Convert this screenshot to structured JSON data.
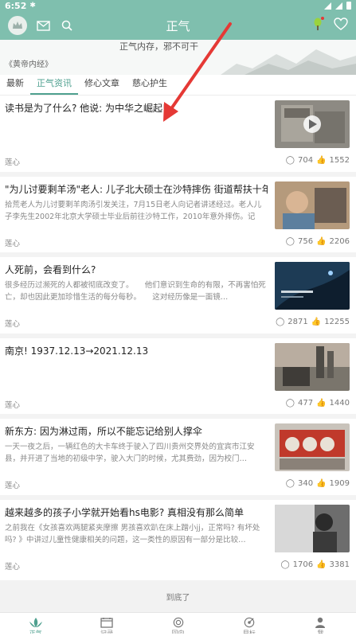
{
  "status_bar": {
    "time": "6:52"
  },
  "header": {
    "title": "正气"
  },
  "banner": {
    "verse": "正气内存，邪不可干",
    "source": "《黄帝内经》"
  },
  "tabs": [
    {
      "label": "最新",
      "active": false
    },
    {
      "label": "正气资讯",
      "active": true
    },
    {
      "label": "修心文章",
      "active": false
    },
    {
      "label": "慈心护生",
      "active": false
    }
  ],
  "articles": [
    {
      "title": "读书是为了什么? 他说: 为中华之崛起!",
      "summary": "",
      "source": "莲心",
      "comments": "704",
      "likes": "1552",
      "has_play": true
    },
    {
      "title": "\"为儿讨要剩羊汤\"老人: 儿子北大硕士在沙特摔伤 街道帮扶十年",
      "summary": "拾荒老人为儿讨要剩羊肉汤引发关注，7月15日老人向记者讲述经过。老人儿子李先生2002年北京大学硕士毕业后前往沙特工作，2010年意外摔伤。记者…",
      "source": "莲心",
      "comments": "756",
      "likes": "2206",
      "has_play": false
    },
    {
      "title": "人死前，会看到什么?",
      "summary": "很多经历过濒死的人都被彻底改变了。　　他们意识到生命的有限，不再害怕死亡，却也因此更加珍惜生活的每分每秒。　　这对经历像是一面镜…",
      "source": "莲心",
      "comments": "2871",
      "likes": "12255",
      "has_play": false
    },
    {
      "title": "南京! 1937.12.13→2021.12.13",
      "summary": "",
      "source": "莲心",
      "comments": "477",
      "likes": "1440",
      "has_play": false
    },
    {
      "title": "新东方: 因为淋过雨，所以不能忘记给别人撑伞",
      "summary": "一天一夜之后，一辆红色的大卡车终于驶入了四川贵州交界处的宜宾市江安县，并开进了当地的初级中学，驶入大门的时候，尤其费劲，因为校门…",
      "source": "莲心",
      "comments": "340",
      "likes": "1909",
      "has_play": false
    },
    {
      "title": "越来越多的孩子小学就开始看hs电影? 真相没有那么简单",
      "summary": "之前我在《女孩喜欢两腿紧夹摩擦 男孩喜欢趴在床上蹭小jj，正常吗? 有坏处吗? 》中讲过儿童性健康相关的问题，这一类性的原因有一部分是比较…",
      "source": "莲心",
      "comments": "1706",
      "likes": "3381",
      "has_play": false
    }
  ],
  "footer": {
    "end_text": "到底了"
  },
  "bottom_nav": [
    {
      "label": "正气",
      "icon": "lotus-icon",
      "active": true
    },
    {
      "label": "记录",
      "icon": "calendar-icon",
      "active": false
    },
    {
      "label": "回向",
      "icon": "circle-icon",
      "active": false
    },
    {
      "label": "目标",
      "icon": "target-icon",
      "active": false
    },
    {
      "label": "我",
      "icon": "person-icon",
      "active": false
    }
  ],
  "colors": {
    "brand": "#7fbfae",
    "accent": "#4ea08f",
    "annotation_arrow": "#e53935"
  }
}
